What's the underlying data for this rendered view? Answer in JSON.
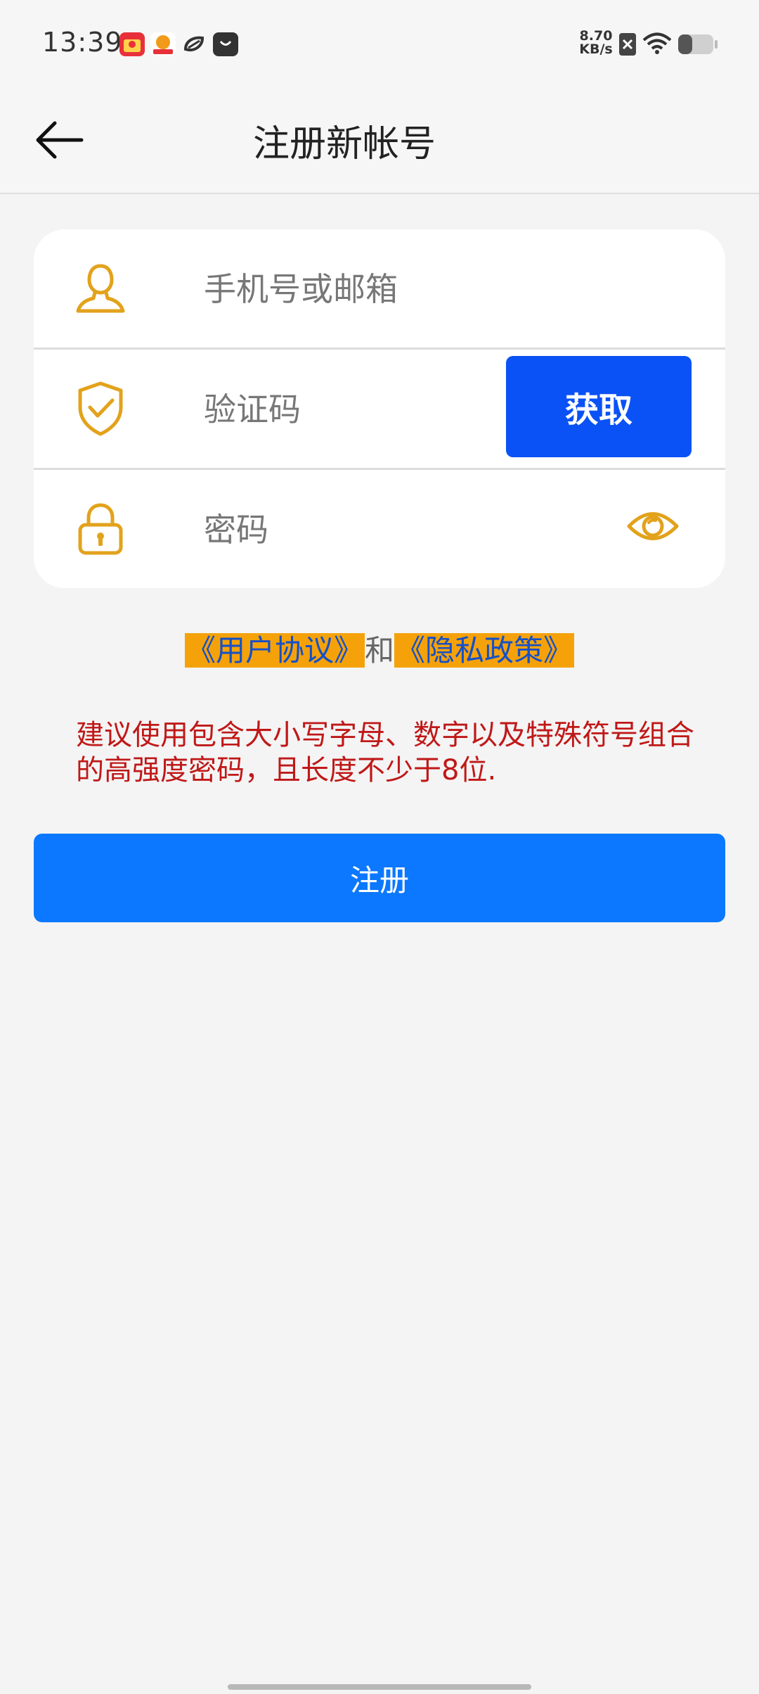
{
  "status_bar": {
    "time": "13:39",
    "net_speed_value": "8.70",
    "net_speed_unit": "KB/s",
    "notification_icons": [
      "shopping-app-icon",
      "delivery-app-icon",
      "link-app-icon",
      "bag-app-icon"
    ],
    "battery_level": 0.35
  },
  "header": {
    "title": "注册新帐号"
  },
  "form": {
    "account_placeholder": "手机号或邮箱",
    "code_placeholder": "验证码",
    "get_code_label": "获取",
    "password_placeholder": "密码"
  },
  "agreement": {
    "user_agreement": "《用户协议》",
    "joiner": "和",
    "privacy_policy": "《隐私政策》"
  },
  "password_hint": "建议使用包含大小写字母、数字以及特殊符号组合的高强度密码，且长度不少于8位.",
  "register_label": "注册",
  "colors": {
    "accent_blue": "#0a52f5",
    "register_blue": "#0b78ff",
    "icon_gold": "#e2a21b",
    "highlight_orange": "#f5a20a",
    "hint_red": "#c01818"
  }
}
